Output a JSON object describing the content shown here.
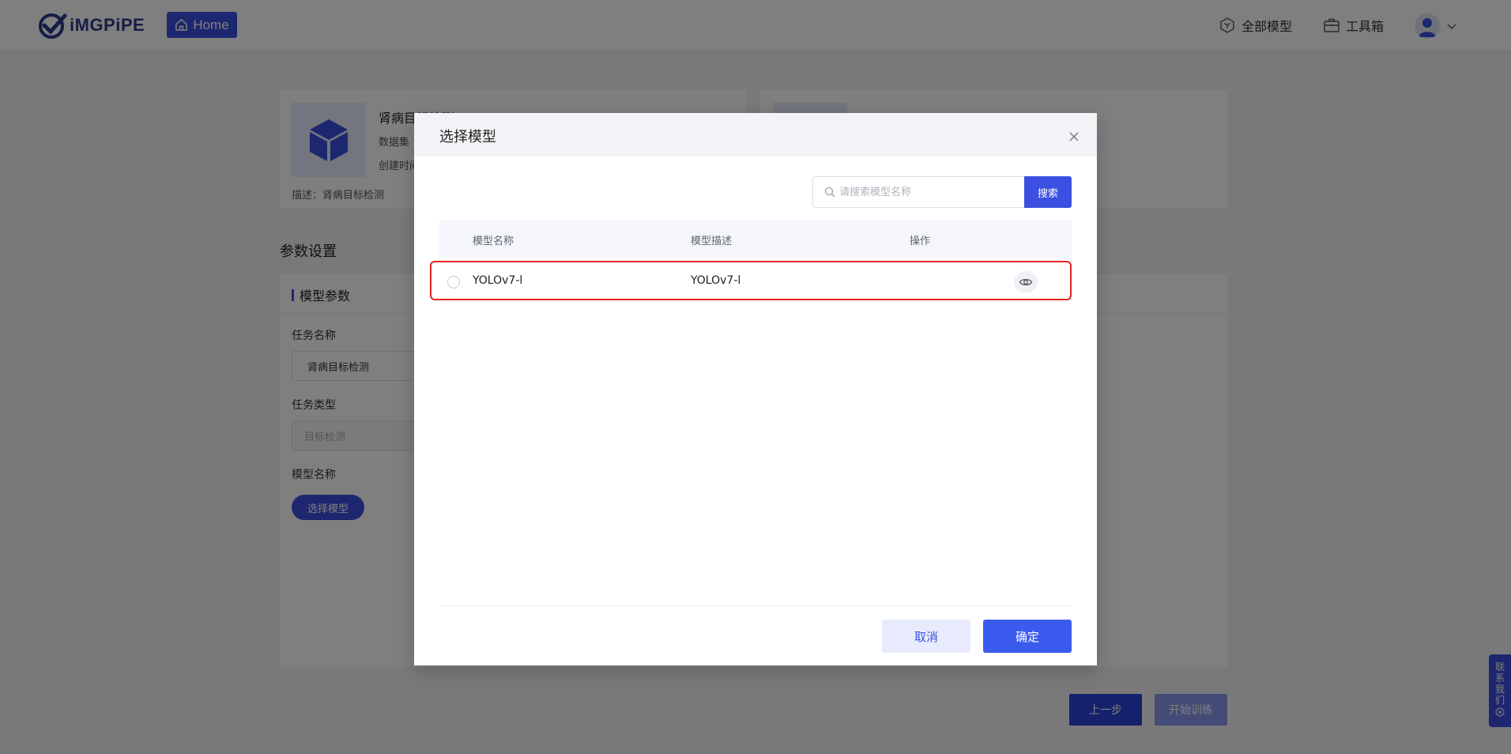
{
  "topbar": {
    "logo_text": "iMGPiPE",
    "home_label": "Home",
    "all_models_label": "全部模型",
    "toolbox_label": "工具箱"
  },
  "dataset_card": {
    "name": "肾病目标检测",
    "meta_dataset": "数据集",
    "meta_created": "创建时间",
    "description": "描述：肾病目标检测"
  },
  "params": {
    "section_title": "参数设置",
    "tab_label": "模型参数",
    "task_name_label": "任务名称",
    "task_name_value": "肾病目标检测",
    "task_type_label": "任务类型",
    "task_type_value": "目标检测",
    "model_name_label": "模型名称",
    "choose_model_label": "选择模型"
  },
  "page_actions": {
    "prev_label": "上一步",
    "start_label": "开始训练"
  },
  "contact": {
    "label": [
      "联",
      "系",
      "我",
      "们"
    ]
  },
  "modal": {
    "title": "选择模型",
    "search_placeholder": "请搜索模型名称",
    "search_label": "搜索",
    "columns": {
      "name": "模型名称",
      "description": "模型描述",
      "actions": "操作"
    },
    "rows": [
      {
        "name": "YOLOv7-l",
        "description": "YOLOv7-l",
        "selected": false
      }
    ],
    "cancel_label": "取消",
    "ok_label": "确定"
  },
  "colors": {
    "primary": "#3b4fe0",
    "highlight_border": "#e02424",
    "overlay": "rgba(0,0,0,0.5)"
  }
}
